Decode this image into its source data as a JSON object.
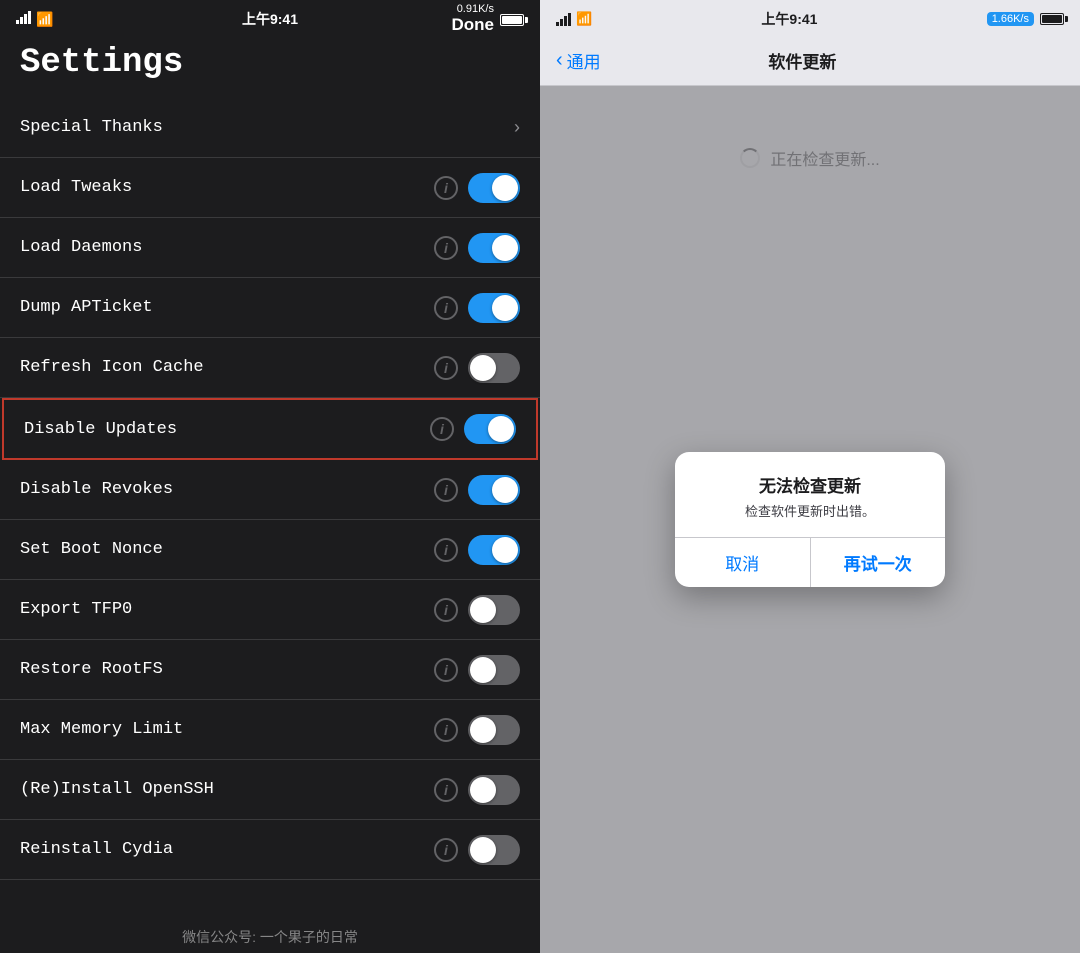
{
  "left": {
    "status": {
      "signal": "●●●●",
      "wifi": "wifi",
      "time": "上午9:41",
      "battery_pct": "100%",
      "speed": "0.91K/s",
      "done": "Done"
    },
    "title": "Settings",
    "items": [
      {
        "id": "special-thanks",
        "label": "Special Thanks",
        "type": "chevron",
        "toggle": null
      },
      {
        "id": "load-tweaks",
        "label": "Load Tweaks",
        "type": "toggle",
        "toggle": "on"
      },
      {
        "id": "load-daemons",
        "label": "Load Daemons",
        "type": "toggle",
        "toggle": "on"
      },
      {
        "id": "dump-apticket",
        "label": "Dump APTicket",
        "type": "toggle",
        "toggle": "on"
      },
      {
        "id": "refresh-icon-cache",
        "label": "Refresh Icon Cache",
        "type": "toggle",
        "toggle": "off"
      },
      {
        "id": "disable-updates",
        "label": "Disable Updates",
        "type": "toggle",
        "toggle": "on",
        "highlighted": true
      },
      {
        "id": "disable-revokes",
        "label": "Disable Revokes",
        "type": "toggle",
        "toggle": "on"
      },
      {
        "id": "set-boot-nonce",
        "label": "Set Boot Nonce",
        "type": "toggle",
        "toggle": "on"
      },
      {
        "id": "export-tfp0",
        "label": "Export TFP0",
        "type": "toggle",
        "toggle": "off"
      },
      {
        "id": "restore-rootfs",
        "label": "Restore RootFS",
        "type": "toggle",
        "toggle": "off"
      },
      {
        "id": "max-memory-limit",
        "label": "Max Memory Limit",
        "type": "toggle",
        "toggle": "off"
      },
      {
        "id": "reinstall-openssh",
        "label": "(Re)Install OpenSSH",
        "type": "toggle",
        "toggle": "off"
      },
      {
        "id": "reinstall-cydia",
        "label": "Reinstall Cydia",
        "type": "toggle",
        "toggle": "off"
      }
    ],
    "watermark": "微信公众号: 一个果子的日常"
  },
  "right": {
    "status": {
      "signal": "●●●●",
      "wifi": "wifi",
      "time": "上午9:41",
      "battery_pct": "100%",
      "speed": "1.66K/s"
    },
    "nav": {
      "back_label": "通用",
      "title": "软件更新"
    },
    "checking_text": "正在检查更新...",
    "alert": {
      "title": "无法检查更新",
      "message": "检查软件更新时出错。",
      "btn_cancel": "取消",
      "btn_retry": "再试一次"
    }
  }
}
